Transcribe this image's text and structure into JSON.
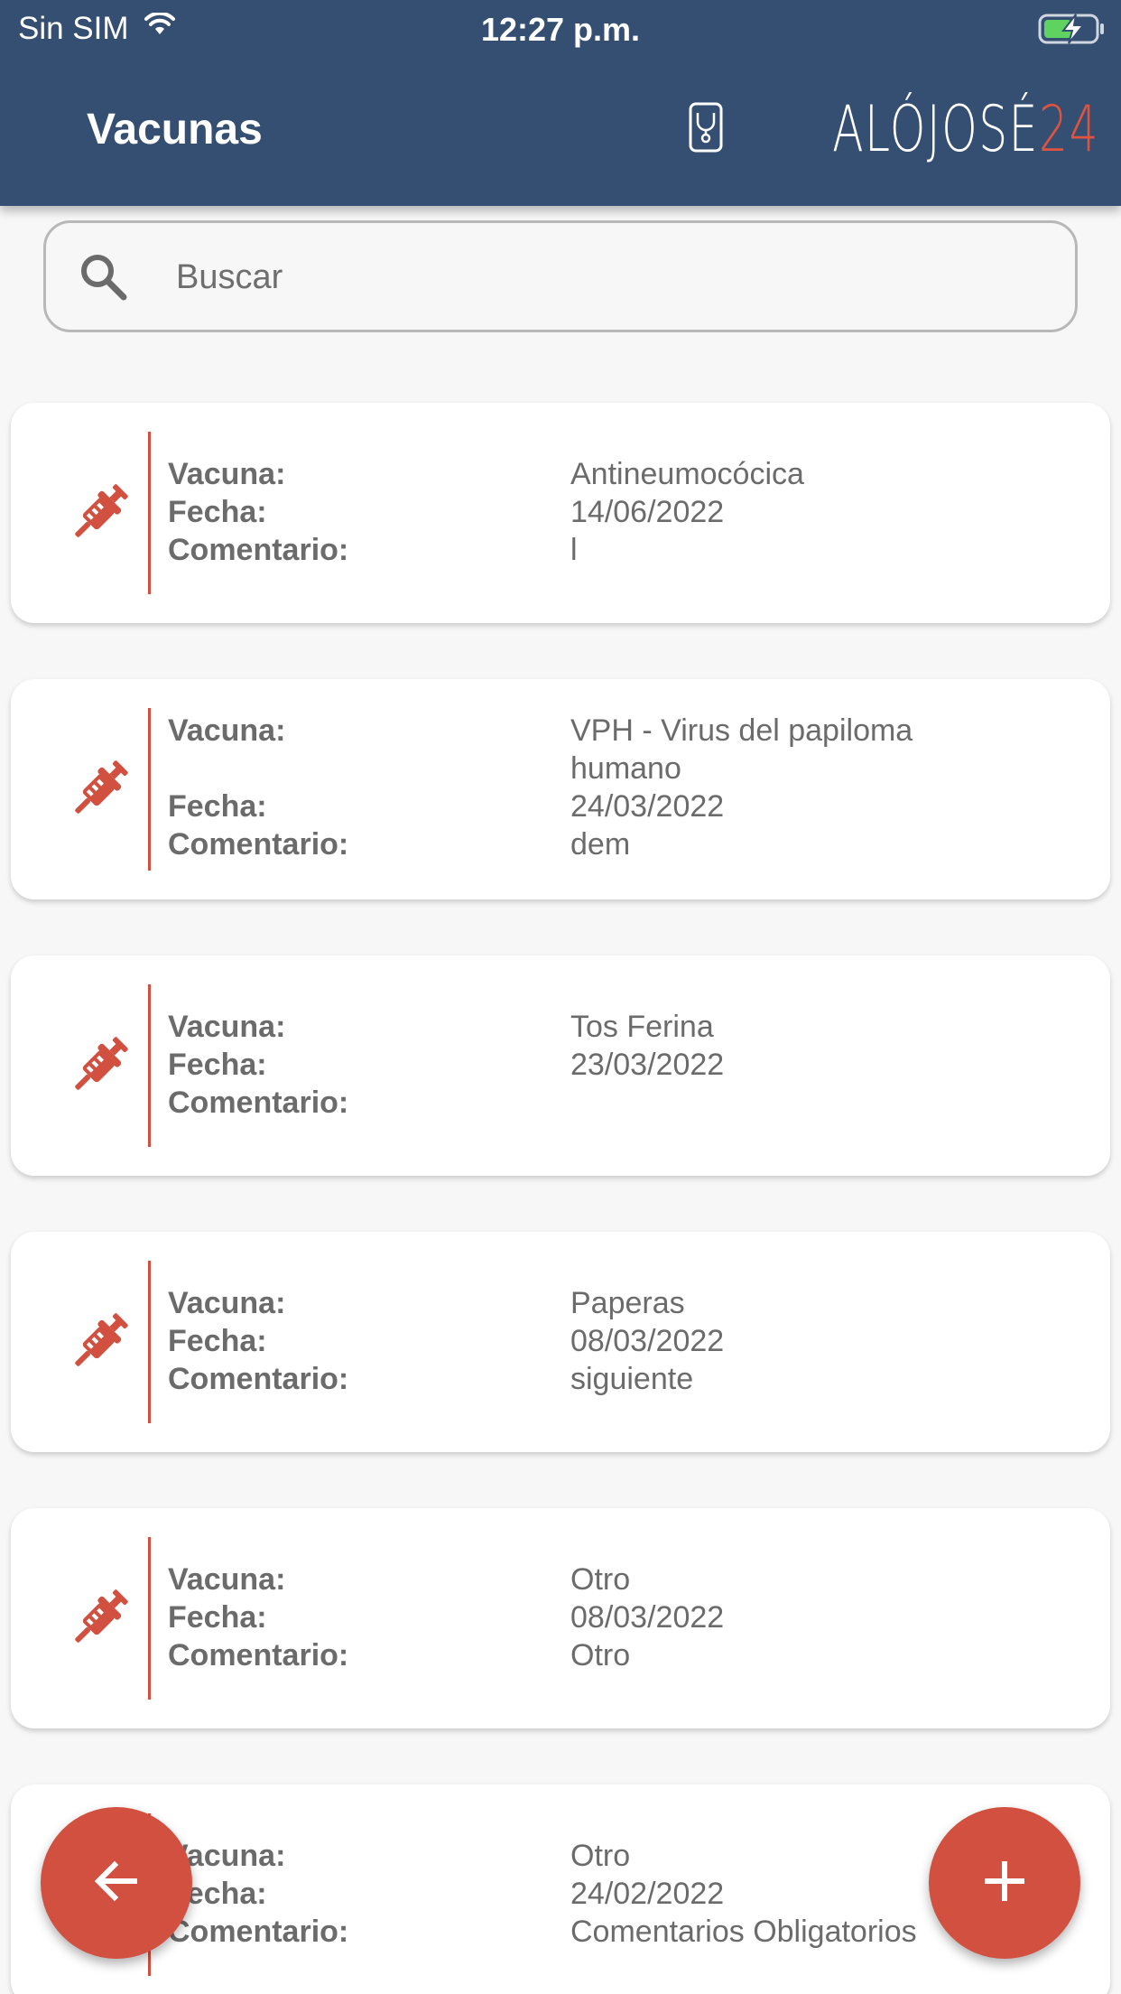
{
  "status_bar": {
    "carrier": "Sin SIM",
    "time": "12:27 p.m.",
    "wifi_icon": "wifi-icon",
    "battery_icon": "battery-charging-icon"
  },
  "header": {
    "title": "Vacunas",
    "logo_text": "ALÓJOSÉ",
    "logo_number": "24",
    "background_color": "#354f73"
  },
  "search": {
    "placeholder": "Buscar",
    "value": "",
    "icon": "search-icon"
  },
  "labels": {
    "vacuna": "Vacuna:",
    "fecha": "Fecha:",
    "comentario": "Comentario:"
  },
  "vaccines": [
    {
      "vacuna": "Antineumocócica",
      "fecha": "14/06/2022",
      "comentario": "l"
    },
    {
      "vacuna": "VPH - Virus del papiloma humano",
      "fecha": "24/03/2022",
      "comentario": "dem"
    },
    {
      "vacuna": "Tos Ferina",
      "fecha": "23/03/2022",
      "comentario": ""
    },
    {
      "vacuna": "Paperas",
      "fecha": "08/03/2022",
      "comentario": "siguiente"
    },
    {
      "vacuna": "Otro",
      "fecha": "08/03/2022",
      "comentario": "Otro"
    },
    {
      "vacuna": "Otro",
      "fecha": "24/02/2022",
      "comentario": "Comentarios Obligatorios"
    }
  ],
  "fab": {
    "back_icon": "arrow-left-icon",
    "add_icon": "plus-icon"
  },
  "colors": {
    "accent": "#d1503f",
    "text": "#6b6b6b",
    "background": "#f7f7f7"
  }
}
